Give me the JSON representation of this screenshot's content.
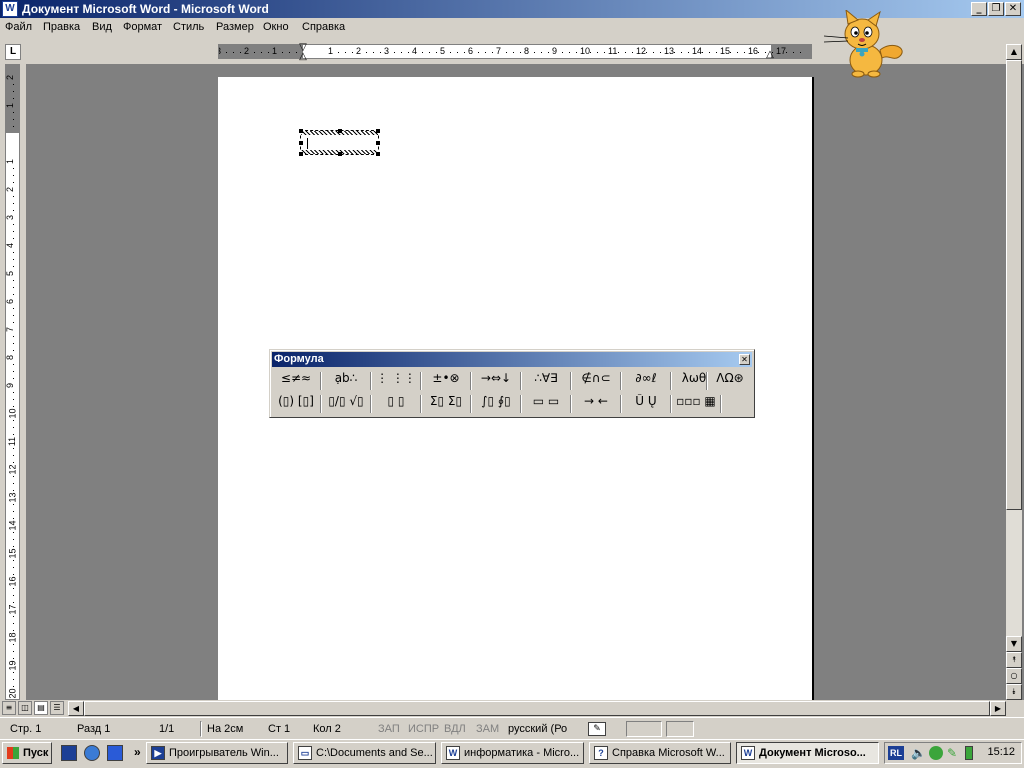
{
  "window": {
    "title": "Документ Microsoft Word - Microsoft Word",
    "app_icon": "W"
  },
  "menu": [
    "Файл",
    "Правка",
    "Вид",
    "Формат",
    "Стиль",
    "Размер",
    "Окно",
    "Справка"
  ],
  "ruler": {
    "tab_selector": "L",
    "h_labels": [
      "3",
      "2",
      "1",
      "1",
      "2",
      "3",
      "4",
      "5",
      "6",
      "7",
      "8",
      "9",
      "10",
      "11",
      "12",
      "13",
      "14",
      "15",
      "16",
      "17"
    ],
    "v_labels": [
      "2",
      "1",
      "1",
      "2",
      "3",
      "4",
      "5",
      "6",
      "7",
      "8",
      "9",
      "10",
      "11",
      "12",
      "13",
      "14",
      "15",
      "16",
      "17",
      "18",
      "19",
      "20"
    ]
  },
  "formula_toolbar": {
    "title": "Формула",
    "row1": [
      "≤≠≈",
      "ạb∴",
      "⋮ ⋮⋮",
      "±•⊗",
      "→⇔↓",
      "∴∀∃",
      "∉∩⊂",
      "∂∞ℓ",
      "λωθ",
      "ΛΩ⊛"
    ],
    "row2": [
      "(▯) [▯]",
      "▯/▯ √▯",
      "▯ ▯",
      "Σ▯ Σ▯",
      "∫▯ ∮▯",
      "▭ ▭",
      "→ ←",
      "Ū Ų",
      "▫▫▫ ▦"
    ]
  },
  "status": {
    "page": "Стр. 1",
    "section": "Разд 1",
    "pages": "1/1",
    "at": "На 2см",
    "line": "Ст 1",
    "col": "Кол 2",
    "rec": "ЗАП",
    "trk": "ИСПР",
    "ext": "ВДЛ",
    "ovr": "ЗАМ",
    "language": "русский (Ро"
  },
  "taskbar": {
    "start": "Пуск",
    "chevron": "»",
    "tasks": [
      {
        "label": "Проигрыватель Win...",
        "active": false
      },
      {
        "label": "C:\\Documents and Se...",
        "active": false
      },
      {
        "label": "информатика - Micro...",
        "active": false
      },
      {
        "label": "Справка Microsoft W...",
        "active": false
      },
      {
        "label": "Документ Microso...",
        "active": true
      }
    ],
    "tray_lang": "RL",
    "clock": "15:12"
  },
  "colors": {
    "title_start": "#0a246a",
    "title_end": "#a6caf0",
    "workspace": "#808080",
    "chrome": "#d4d0c8"
  }
}
